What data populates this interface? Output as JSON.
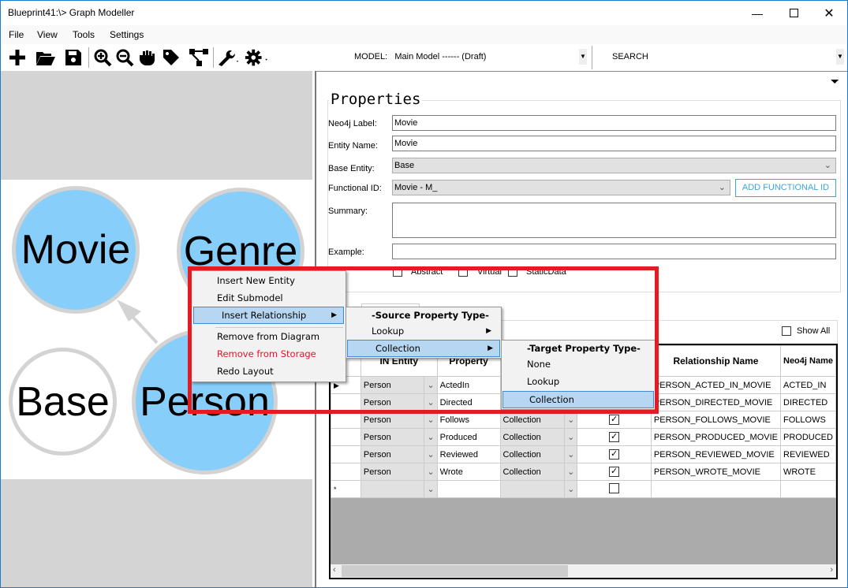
{
  "window": {
    "title": "Blueprint41:\\> Graph Modeller",
    "minimize_icon": "minimize-icon",
    "maximize_icon": "maximize-icon",
    "close_icon": "close-icon"
  },
  "menubar": [
    {
      "label": "File",
      "mnemonic": "F"
    },
    {
      "label": "View",
      "mnemonic": "V"
    },
    {
      "label": "Tools",
      "mnemonic": "T"
    },
    {
      "label": "Settings",
      "mnemonic": "S"
    }
  ],
  "toolbar": {
    "icons": [
      "add-icon",
      "open-folder-icon",
      "save-icon",
      "zoom-in-icon",
      "zoom-out-icon",
      "pan-hand-icon",
      "tag-icon",
      "hierarchy-icon",
      "wrench-icon",
      "gear-icon"
    ],
    "model_label": "MODEL:",
    "model_value": "Main Model ------ (Draft)",
    "search_label": "SEARCH"
  },
  "diagram": {
    "nodes": [
      {
        "label": "Movie",
        "fill": "#87cefa"
      },
      {
        "label": "Genre",
        "fill": "#87cefa"
      },
      {
        "label": "Base",
        "fill": "#ffffff"
      },
      {
        "label": "Person",
        "fill": "#87cefa"
      }
    ],
    "edges": [
      {
        "from": "Person",
        "to": "Movie"
      }
    ]
  },
  "properties": {
    "title": "Properties",
    "neo4j_label": {
      "label": "Neo4j Label:",
      "value": "Movie"
    },
    "entity_name": {
      "label": "Entity Name:",
      "value": "Movie"
    },
    "base_entity": {
      "label": "Base Entity:",
      "value": "Base"
    },
    "functional_id": {
      "label": "Functional ID:",
      "value": "Movie - M_",
      "button": "ADD FUNCTIONAL ID"
    },
    "summary": {
      "label": "Summary:",
      "value": ""
    },
    "example": {
      "label": "Example:",
      "value": ""
    },
    "flags": [
      {
        "label": "Abstract",
        "checked": false
      },
      {
        "label": "Virtual",
        "checked": false
      },
      {
        "label": "StaticData",
        "checked": false
      }
    ]
  },
  "relationships": {
    "show_all": {
      "label": "Show All",
      "checked": false
    },
    "columns": [
      "",
      "IN Entity",
      "",
      "Property",
      "",
      "",
      "",
      "Relationship Name",
      "Neo4j Name"
    ],
    "header_in_entity": "IN Entity",
    "header_property": "Property",
    "header_relationship": "Relationship Name",
    "header_neo4j": "Neo4j Name",
    "rows": [
      {
        "in_entity": "Person",
        "property": "ActedIn",
        "type": "",
        "checked": null,
        "rel_name": "PERSON_ACTED_IN_MOVIE",
        "neo4j": "ACTED_IN",
        "current": true
      },
      {
        "in_entity": "Person",
        "property": "Directed",
        "type": "",
        "checked": null,
        "rel_name": "PERSON_DIRECTED_MOVIE",
        "neo4j": "DIRECTED"
      },
      {
        "in_entity": "Person",
        "property": "Follows",
        "type": "Collection",
        "checked": true,
        "rel_name": "PERSON_FOLLOWS_MOVIE",
        "neo4j": "FOLLOWS"
      },
      {
        "in_entity": "Person",
        "property": "Produced",
        "type": "Collection",
        "checked": true,
        "rel_name": "PERSON_PRODUCED_MOVIE",
        "neo4j": "PRODUCED"
      },
      {
        "in_entity": "Person",
        "property": "Reviewed",
        "type": "Collection",
        "checked": true,
        "rel_name": "PERSON_REVIEWED_MOVIE",
        "neo4j": "REVIEWED"
      },
      {
        "in_entity": "Person",
        "property": "Wrote",
        "type": "Collection",
        "checked": true,
        "rel_name": "PERSON_WROTE_MOVIE",
        "neo4j": "WROTE"
      },
      {
        "in_entity": "",
        "property": "",
        "type": "",
        "checked": false,
        "rel_name": "",
        "neo4j": "",
        "new_row": true
      }
    ]
  },
  "context_menu": {
    "items": [
      {
        "label": "Insert New Entity"
      },
      {
        "label": "Edit Submodel"
      },
      {
        "label": "Insert Relationship",
        "submenu": true,
        "highlighted": true
      },
      {
        "label": "Remove from Diagram"
      },
      {
        "label": "Remove from Storage",
        "color": "#e81123"
      },
      {
        "label": "Redo Layout"
      }
    ],
    "source_submenu": {
      "header": "-Source Property Type-",
      "items": [
        {
          "label": "Lookup",
          "submenu": true
        },
        {
          "label": "Collection",
          "submenu": true,
          "highlighted": true
        }
      ]
    },
    "target_submenu": {
      "header": "-Target Property Type-",
      "items": [
        {
          "label": "None"
        },
        {
          "label": "Lookup"
        },
        {
          "label": "Collection",
          "highlighted": true
        }
      ]
    }
  },
  "colors": {
    "accent": "#39a7dd",
    "highlight": "#b6d6f2",
    "annotation": "#e31b23",
    "node_fill": "#87cefa"
  }
}
